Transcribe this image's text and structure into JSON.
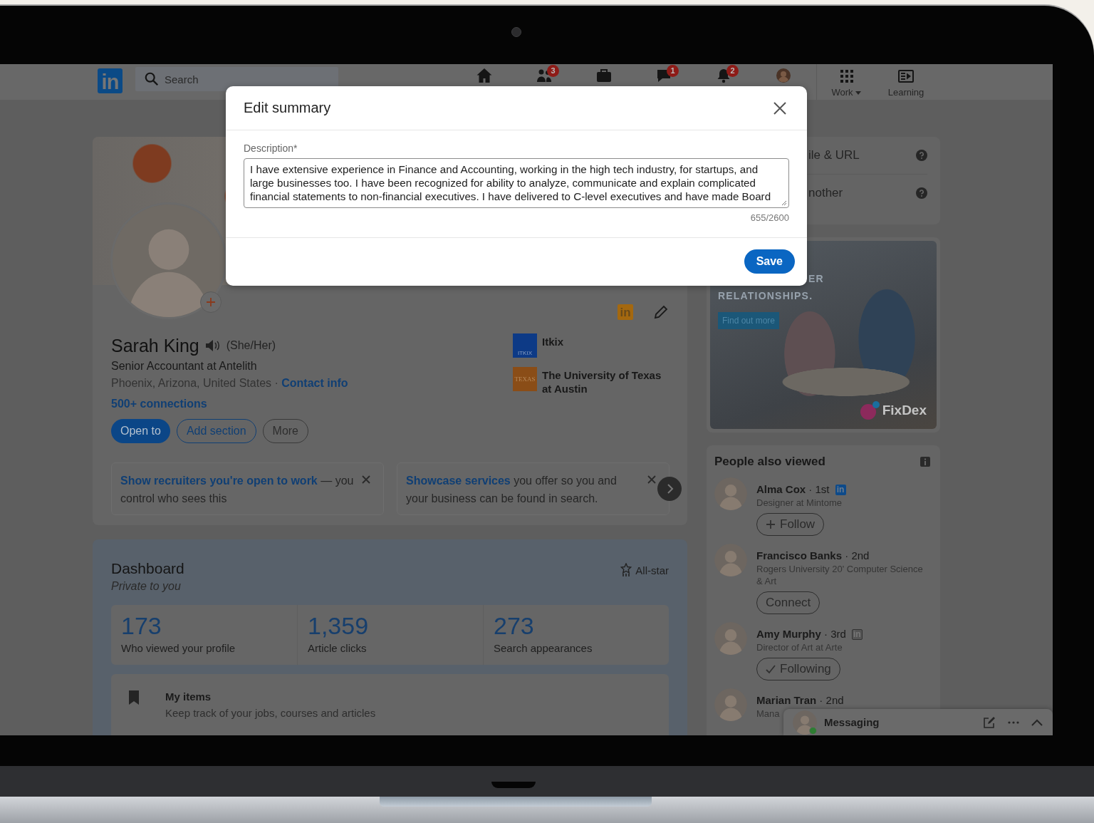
{
  "nav": {
    "logo": "in",
    "search": {
      "placeholder": "Search"
    },
    "items": [
      {
        "kind": "home"
      },
      {
        "kind": "network",
        "badge": "3"
      },
      {
        "kind": "jobs"
      },
      {
        "kind": "messaging",
        "badge": "1"
      },
      {
        "kind": "notifications",
        "badge": "2"
      },
      {
        "kind": "me"
      },
      {
        "kind": "work",
        "label": "Work"
      },
      {
        "kind": "learning",
        "label": "Learning"
      }
    ]
  },
  "profile": {
    "name": "Sarah King",
    "pronouns": "(She/Her)",
    "headline": "Senior Accountant at Antelith",
    "location": "Phoenix, Arizona, United States ·",
    "contact_link": "Contact info",
    "connections": "500+ connections",
    "badge": "in",
    "buttons": [
      {
        "label": "Open to",
        "kind": "primary"
      },
      {
        "label": "Add section",
        "kind": "secondary"
      },
      {
        "label": "More",
        "kind": "plain"
      }
    ],
    "organizations": [
      {
        "name": "Itkix",
        "logo_text": "ITKIX",
        "kind": "company"
      },
      {
        "name": "The University of Texas at Austin",
        "logo_text": "TEXAS",
        "kind": "school"
      }
    ],
    "promos": [
      {
        "link": "Show recruiters you're open to work",
        "text": " — you control who sees this"
      },
      {
        "link": "Showcase services",
        "text": " you offer so you and your business can be found in search."
      }
    ]
  },
  "dashboard": {
    "title": "Dashboard",
    "subtitle": "Private to you",
    "strength": "All-star",
    "stats": [
      {
        "value": "173",
        "label": "Who viewed your profile"
      },
      {
        "value": "1,359",
        "label": "Article clicks"
      },
      {
        "value": "273",
        "label": "Search appearances"
      }
    ],
    "my_items": {
      "title": "My items",
      "text": "Keep track of your jobs, courses and articles"
    }
  },
  "sidebar": {
    "settings": [
      "ile & URL",
      "nother"
    ],
    "ad": {
      "headline": [
        "ER",
        "RELATIONSHIPS."
      ],
      "button": "Find out more",
      "brand": "FixDex"
    },
    "people_also_viewed": {
      "title": "People also viewed",
      "people": [
        {
          "name": "**Alma Cox** · 1st",
          "badge": {
            "text": "in",
            "kind": "filled"
          },
          "headline": "Designer at Mintome",
          "action": {
            "kind": "follow",
            "label": "Follow"
          }
        },
        {
          "name": "**Francisco Banks** · 2nd",
          "headline": "Rogers University 20' Computer Science & Art",
          "action": {
            "kind": "connect",
            "label": "Connect"
          }
        },
        {
          "name": "**Amy Murphy** · 3rd",
          "badge": {
            "text": "in",
            "kind": "outline"
          },
          "headline": "Director of Art at Arte",
          "action": {
            "kind": "following",
            "label": "Following"
          }
        },
        {
          "name": "**Marian Tran** · 2nd",
          "headline": "Mana"
        }
      ]
    }
  },
  "messaging": {
    "title": "Messaging",
    "online": true
  },
  "modal": {
    "title": "Edit summary",
    "field": {
      "label": "Description*",
      "value": "I have extensive experience in Finance and Accounting, working in the high tech industry, for startups, and large businesses too. I have been recognized for ability to analyze, communicate and explain complicated financial statements to non-financial executives. I have delivered to C-level executives and have made Board"
    },
    "counter": "655/2600",
    "save": "Save"
  }
}
